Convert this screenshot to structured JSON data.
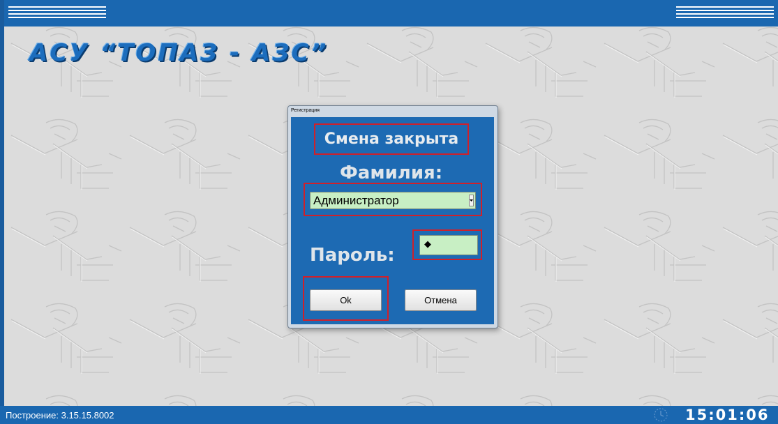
{
  "app": {
    "title": "АСУ “ТОПАЗ - АЗС”"
  },
  "top_bar": {
    "left_menu_icon": "hamburger-icon",
    "right_menu_icon": "hamburger-icon"
  },
  "status_bar": {
    "build_label": "Построение: 3.15.15.8002",
    "clock_icon": "clock-icon",
    "time": "15:01:06"
  },
  "dialog": {
    "window_title": "Регистрация",
    "shift_status": "Смена закрыта",
    "surname_label": "Фамилия:",
    "user_select_value": "Администратор",
    "password_label": "Пароль:",
    "password_value": "◆",
    "ok_label": "Ok",
    "cancel_label": "Отмена"
  },
  "colors": {
    "bar_blue": "#1a67b0",
    "dialog_blue": "#1d6ab3",
    "field_green": "#c8efc4",
    "highlight_red": "#d0202a"
  }
}
